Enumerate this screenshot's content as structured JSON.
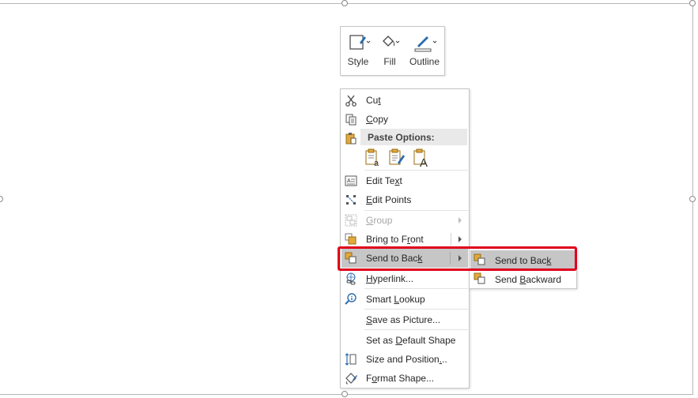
{
  "mini_toolbar": {
    "style_label": "Style",
    "fill_label": "Fill",
    "outline_label": "Outline"
  },
  "context_menu": {
    "cut": {
      "pre": "Cu",
      "key": "t",
      "post": ""
    },
    "copy": {
      "pre": "",
      "key": "C",
      "post": "opy"
    },
    "paste_options": "Paste Options:",
    "edit_text": {
      "pre": "Edit Te",
      "key": "x",
      "post": "t"
    },
    "edit_points": {
      "pre": "",
      "key": "E",
      "post": "dit Points"
    },
    "group": {
      "pre": "",
      "key": "G",
      "post": "roup"
    },
    "bring_to_front": {
      "pre": "Bring to F",
      "key": "r",
      "post": "ont"
    },
    "send_to_back": {
      "pre": "Send to Bac",
      "key": "k",
      "post": ""
    },
    "hyperlink": {
      "pre": "",
      "key": "H",
      "post": "yperlink..."
    },
    "smart_lookup": {
      "pre": "Smart ",
      "key": "L",
      "post": "ookup"
    },
    "save_as_picture": {
      "pre": "",
      "key": "S",
      "post": "ave as Picture..."
    },
    "set_default": {
      "pre": "Set as ",
      "key": "D",
      "post": "efault Shape"
    },
    "size_position": {
      "pre": "Size and Position",
      "key": ".",
      "post": ".."
    },
    "format_shape": {
      "pre": "F",
      "key": "o",
      "post": "rmat Shape..."
    }
  },
  "submenu": {
    "send_to_back": {
      "pre": "Send to Bac",
      "key": "k",
      "post": ""
    },
    "send_backward": {
      "pre": "Send ",
      "key": "B",
      "post": "ackward"
    }
  },
  "colors": {
    "highlight": "#c6c6c6",
    "annotation_box": "#e0001b",
    "icon_blue": "#2b6cb0",
    "icon_gold": "#e2a93b"
  }
}
